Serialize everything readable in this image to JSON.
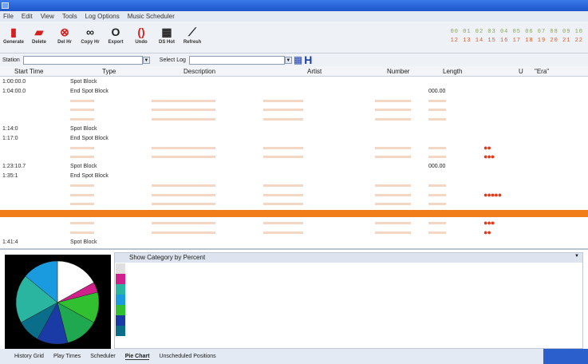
{
  "menu": [
    "File",
    "Edit",
    "View",
    "Tools",
    "Log Options",
    "Music Scheduler"
  ],
  "toolbar": [
    {
      "label": "Generate",
      "icon": "generate-icon",
      "glyph": "▮",
      "cls": "ic-red"
    },
    {
      "label": "Delete",
      "icon": "delete-icon",
      "glyph": "▰",
      "cls": "ic-red"
    },
    {
      "label": "Del Hr",
      "icon": "del-hour-icon",
      "glyph": "⊗",
      "cls": "ic-red"
    },
    {
      "label": "Copy Hr",
      "icon": "copy-hour-icon",
      "glyph": "∞",
      "cls": "ic-dark"
    },
    {
      "label": "Export",
      "icon": "export-icon",
      "glyph": "O",
      "cls": "ic-dark"
    },
    {
      "label": "Undo",
      "icon": "undo-icon",
      "glyph": "()",
      "cls": "ic-red"
    },
    {
      "label": "DS Hot",
      "icon": "ds-hot-icon",
      "glyph": "▦",
      "cls": "ic-dark"
    },
    {
      "label": "Refresh",
      "icon": "refresh-icon",
      "glyph": "⟋",
      "cls": "ic-dark"
    }
  ],
  "hour_grid": {
    "row1": "00 01 02 03 04 05 06 07 08 09 10",
    "row2": "12 13 14 15 16 17 18 19 20 21 22"
  },
  "selectors": {
    "station_label": "Station",
    "station_value": "",
    "log_label": "Select Log",
    "log_value": "",
    "status_text": ""
  },
  "columns": [
    "Start Time",
    "Type",
    "Description",
    "Artist",
    "Number",
    "Length",
    "U",
    "\"Era\""
  ],
  "rows": [
    {
      "time": "1:00:00.0",
      "type": "Spot Block",
      "kind": "block",
      "desc": "",
      "artist": "",
      "number": "",
      "length": "",
      "dots": ""
    },
    {
      "time": "1:04:00.0",
      "type": "End Spot Block",
      "kind": "block",
      "desc": "",
      "artist": "",
      "number": "",
      "length": "000.00",
      "dots": ""
    },
    {
      "time": "",
      "type": "",
      "kind": "faded",
      "desc": "",
      "artist": "",
      "number": "",
      "length": "",
      "dots": ""
    },
    {
      "time": "",
      "type": "",
      "kind": "faded",
      "desc": "",
      "artist": "",
      "number": "",
      "length": "",
      "dots": ""
    },
    {
      "time": "",
      "type": "",
      "kind": "faded",
      "desc": "",
      "artist": "",
      "number": "",
      "length": "",
      "dots": ""
    },
    {
      "time": "1:14:0",
      "type": "Spot Block",
      "kind": "block",
      "desc": "",
      "artist": "",
      "number": "",
      "length": "",
      "dots": ""
    },
    {
      "time": "1:17:0",
      "type": "End Spot Block",
      "kind": "block",
      "desc": "",
      "artist": "",
      "number": "",
      "length": "",
      "dots": ""
    },
    {
      "time": "",
      "type": "",
      "kind": "faded",
      "desc": "",
      "artist": "",
      "number": "",
      "length": "",
      "dots": "●●"
    },
    {
      "time": "",
      "type": "",
      "kind": "faded",
      "desc": "",
      "artist": "",
      "number": "",
      "length": "",
      "dots": "●●●"
    },
    {
      "time": "1:23:10.7",
      "type": "Spot Block",
      "kind": "block",
      "desc": "",
      "artist": "",
      "number": "",
      "length": "000.00",
      "dots": ""
    },
    {
      "time": "1:35:1",
      "type": "End Spot Block",
      "kind": "block",
      "desc": "",
      "artist": "",
      "number": "",
      "length": "",
      "dots": ""
    },
    {
      "time": "",
      "type": "",
      "kind": "faded",
      "desc": "",
      "artist": "",
      "number": "",
      "length": "",
      "dots": ""
    },
    {
      "time": "",
      "type": "",
      "kind": "faded",
      "desc": "",
      "artist": "",
      "number": "",
      "length": "",
      "dots": "●●●●●"
    },
    {
      "time": "",
      "type": "",
      "kind": "faded",
      "desc": "",
      "artist": "",
      "number": "",
      "length": "",
      "dots": ""
    },
    {
      "time": "",
      "type": "",
      "kind": "sel",
      "desc": "",
      "artist": "",
      "number": "",
      "length": "",
      "dots": ""
    },
    {
      "time": "",
      "type": "",
      "kind": "faded",
      "desc": "",
      "artist": "",
      "number": "",
      "length": "",
      "dots": "●●●"
    },
    {
      "time": "",
      "type": "",
      "kind": "faded",
      "desc": "",
      "artist": "",
      "number": "",
      "length": "",
      "dots": "●●"
    },
    {
      "time": "1:41:4",
      "type": "Spot Block",
      "kind": "block",
      "desc": "",
      "artist": "",
      "number": "",
      "length": "",
      "dots": ""
    }
  ],
  "legend": {
    "title": "Show Category by Percent",
    "items": [
      {
        "label": "",
        "color": "#e0e0e0"
      },
      {
        "label": "",
        "color": "#d0208a"
      },
      {
        "label": "",
        "color": "#2ab5a0"
      },
      {
        "label": "",
        "color": "#1a9be0"
      },
      {
        "label": "",
        "color": "#30c030"
      },
      {
        "label": "",
        "color": "#1a3aa6"
      },
      {
        "label": "",
        "color": "#0a6e8a"
      },
      {
        "label": "",
        "color": "#ffffff"
      }
    ]
  },
  "pie_colors": [
    "#ffffff",
    "#d0208a",
    "#30c030",
    "#20a850",
    "#1a3aa6",
    "#0a6e8a",
    "#2ab5a0",
    "#1a9be0"
  ],
  "pie_fractions": [
    0.17,
    0.04,
    0.12,
    0.13,
    0.12,
    0.09,
    0.19,
    0.14
  ],
  "tabs": [
    "History Grid",
    "Play Times",
    "Scheduler",
    "Pie Chart",
    "Unscheduled Positions"
  ],
  "active_tab": "Pie Chart"
}
